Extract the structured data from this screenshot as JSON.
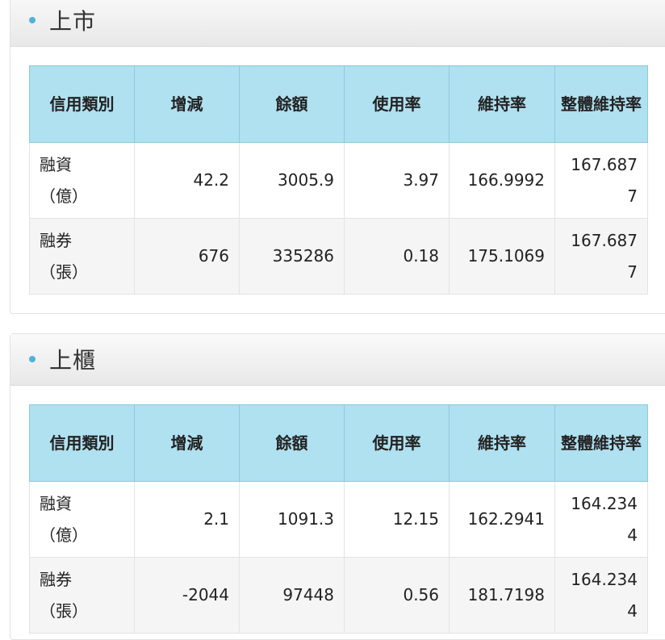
{
  "sections": [
    {
      "title": "上市",
      "headers": [
        "信用類別",
        "增減",
        "餘額",
        "使用率",
        "維持率",
        "整體維持率"
      ],
      "rows": [
        {
          "type_main": "融資",
          "type_unit": "（億）",
          "change": "42.2",
          "balance": "3005.9",
          "usage": "3.97",
          "maintenance": "166.9992",
          "overall": "167.6877"
        },
        {
          "type_main": "融券",
          "type_unit": "（張）",
          "change": "676",
          "balance": "335286",
          "usage": "0.18",
          "maintenance": "175.1069",
          "overall": "167.6877"
        }
      ]
    },
    {
      "title": "上櫃",
      "headers": [
        "信用類別",
        "增減",
        "餘額",
        "使用率",
        "維持率",
        "整體維持率"
      ],
      "rows": [
        {
          "type_main": "融資",
          "type_unit": "（億）",
          "change": "2.1",
          "balance": "1091.3",
          "usage": "12.15",
          "maintenance": "162.2941",
          "overall": "164.2344"
        },
        {
          "type_main": "融券",
          "type_unit": "（張）",
          "change": "-2044",
          "balance": "97448",
          "usage": "0.56",
          "maintenance": "181.7198",
          "overall": "164.2344"
        }
      ]
    }
  ],
  "colors": {
    "bullet": "#4fb3d9",
    "header_bg": "#b0e1f1",
    "alt_row_bg": "#f5f5f5"
  }
}
